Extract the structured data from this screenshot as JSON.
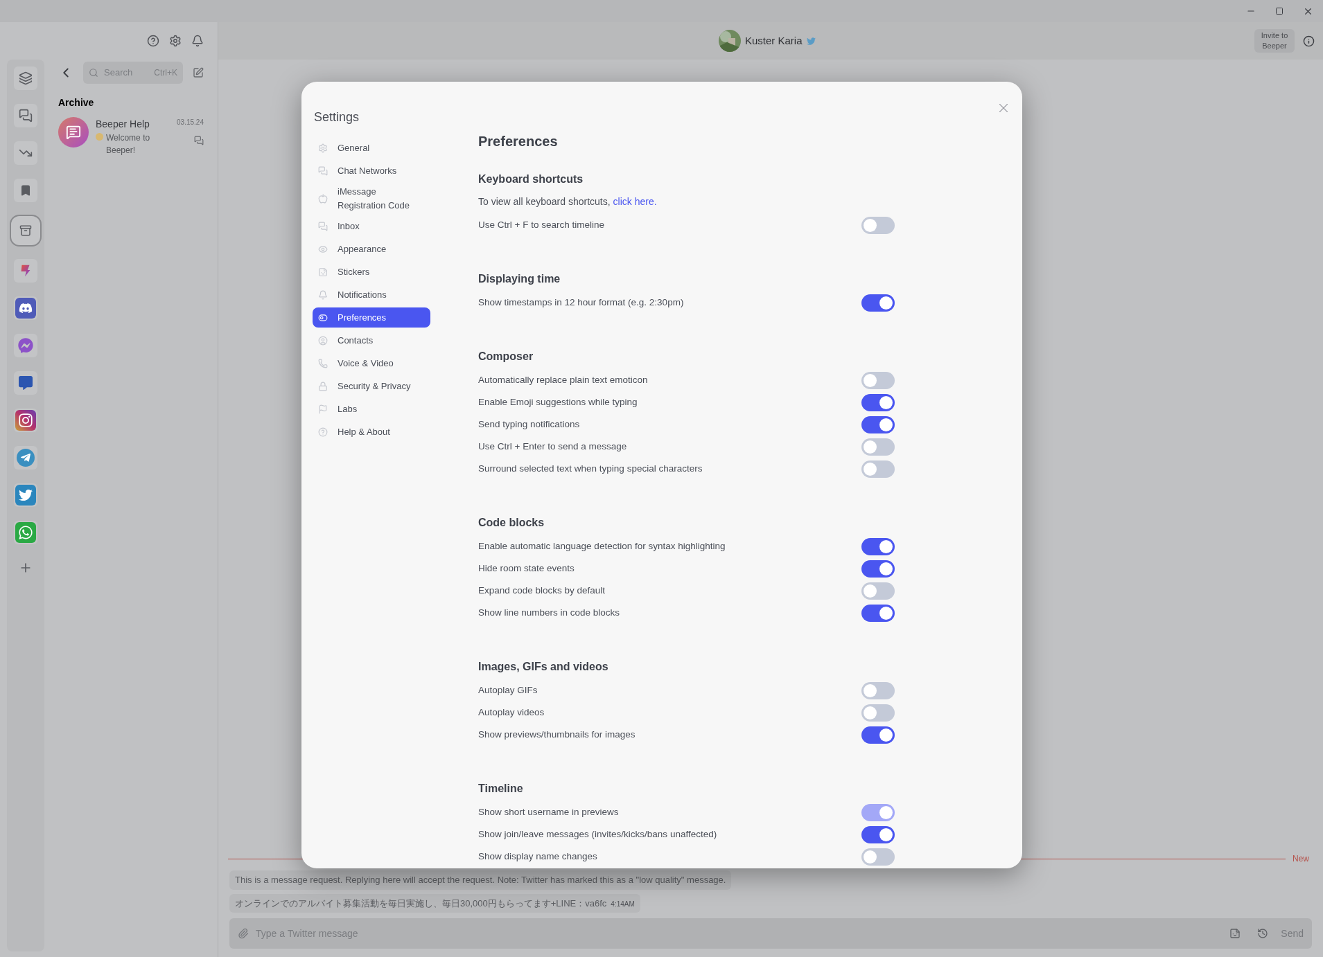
{
  "header": {
    "contact_name": "Kuster Karia",
    "invite_button": "Invite to Beeper"
  },
  "rail_items": [
    {
      "selected": false
    },
    {
      "selected": false
    },
    {
      "selected": false
    },
    {
      "selected": false
    },
    {
      "selected": true
    },
    {
      "selected": false
    },
    {
      "selected": false
    },
    {
      "selected": false
    },
    {
      "selected": false
    },
    {
      "selected": false
    },
    {
      "selected": false
    },
    {
      "selected": false
    },
    {
      "selected": false
    }
  ],
  "chat_list": {
    "search_placeholder": "Search",
    "search_shortcut": "Ctrl+K",
    "heading": "Archive",
    "chats": [
      {
        "name": "Beeper Help",
        "preview": "Welcome to Beeper!",
        "time": "03.15.24"
      }
    ]
  },
  "timeline": {
    "divider": "New",
    "messages": [
      {
        "text": "This is a message request. Replying here will accept the request. Note: Twitter has marked this as a \"low quality\" message."
      },
      {
        "text": "オンラインでのアルバイト募集活動を毎日実施し、毎日30,000円もらってます+LINE：va6fc",
        "time": "4:14AM"
      }
    ]
  },
  "composer": {
    "placeholder": "Type a Twitter message",
    "send": "Send"
  },
  "settings": {
    "title": "Settings",
    "nav": [
      {
        "label": "General",
        "selected": false
      },
      {
        "label": "Chat Networks",
        "selected": false
      },
      {
        "label": "iMessage Registration Code",
        "selected": false
      },
      {
        "label": "Inbox",
        "selected": false
      },
      {
        "label": "Appearance",
        "selected": false
      },
      {
        "label": "Stickers",
        "selected": false
      },
      {
        "label": "Notifications",
        "selected": false
      },
      {
        "label": "Preferences",
        "selected": true
      },
      {
        "label": "Contacts",
        "selected": false
      },
      {
        "label": "Voice & Video",
        "selected": false
      },
      {
        "label": "Security & Privacy",
        "selected": false
      },
      {
        "label": "Labs",
        "selected": false
      },
      {
        "label": "Help & About",
        "selected": false
      }
    ],
    "page_title": "Preferences",
    "sections": [
      {
        "title": "Keyboard shortcuts",
        "note": "To view all keyboard shortcuts,",
        "link": "click here.",
        "rows": [
          {
            "label": "Use Ctrl + F to search timeline",
            "on": false,
            "disabled": false
          }
        ]
      },
      {
        "title": "Displaying time",
        "rows": [
          {
            "label": "Show timestamps in 12 hour format (e.g. 2:30pm)",
            "on": true,
            "disabled": false
          }
        ]
      },
      {
        "title": "Composer",
        "rows": [
          {
            "label": "Automatically replace plain text emoticon",
            "on": false,
            "disabled": false
          },
          {
            "label": "Enable Emoji suggestions while typing",
            "on": true,
            "disabled": false
          },
          {
            "label": "Send typing notifications",
            "on": true,
            "disabled": false
          },
          {
            "label": "Use Ctrl + Enter to send a message",
            "on": false,
            "disabled": false
          },
          {
            "label": "Surround selected text when typing special characters",
            "on": false,
            "disabled": false
          }
        ]
      },
      {
        "title": "Code blocks",
        "rows": [
          {
            "label": "Enable automatic language detection for syntax highlighting",
            "on": true,
            "disabled": false
          },
          {
            "label": "Hide room state events",
            "on": true,
            "disabled": false
          },
          {
            "label": "Expand code blocks by default",
            "on": false,
            "disabled": false
          },
          {
            "label": "Show line numbers in code blocks",
            "on": true,
            "disabled": false
          }
        ]
      },
      {
        "title": "Images, GIFs and videos",
        "rows": [
          {
            "label": "Autoplay GIFs",
            "on": false,
            "disabled": false
          },
          {
            "label": "Autoplay videos",
            "on": false,
            "disabled": false
          },
          {
            "label": "Show previews/thumbnails for images",
            "on": true,
            "disabled": false
          }
        ]
      },
      {
        "title": "Timeline",
        "rows": [
          {
            "label": "Show short username in previews",
            "on": true,
            "disabled": true
          },
          {
            "label": "Show join/leave messages (invites/kicks/bans unaffected)",
            "on": true,
            "disabled": false
          },
          {
            "label": "Show display name changes",
            "on": false,
            "disabled": false
          }
        ]
      }
    ]
  }
}
